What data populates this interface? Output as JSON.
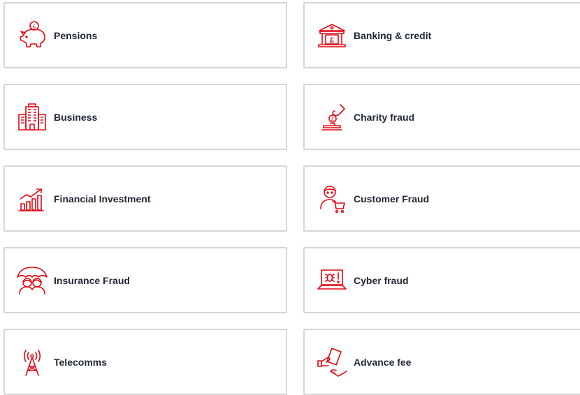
{
  "accent_color": "#e30613",
  "categories": [
    {
      "id": "pensions",
      "label": "Pensions",
      "icon": "piggy-bank-icon"
    },
    {
      "id": "banking",
      "label": "Banking & credit",
      "icon": "bank-building-icon"
    },
    {
      "id": "business",
      "label": "Business",
      "icon": "office-building-icon"
    },
    {
      "id": "charity",
      "label": "Charity fraud",
      "icon": "charity-donation-icon"
    },
    {
      "id": "financial",
      "label": "Financial Investment",
      "icon": "growth-chart-icon"
    },
    {
      "id": "customer",
      "label": "Customer Fraud",
      "icon": "shopper-cart-icon"
    },
    {
      "id": "insurance",
      "label": "Insurance Fraud",
      "icon": "family-umbrella-icon"
    },
    {
      "id": "cyber",
      "label": "Cyber fraud",
      "icon": "laptop-bug-icon"
    },
    {
      "id": "telecomms",
      "label": "Telecomms",
      "icon": "radio-tower-icon"
    },
    {
      "id": "advance",
      "label": "Advance fee",
      "icon": "hand-passing-money-icon"
    }
  ]
}
